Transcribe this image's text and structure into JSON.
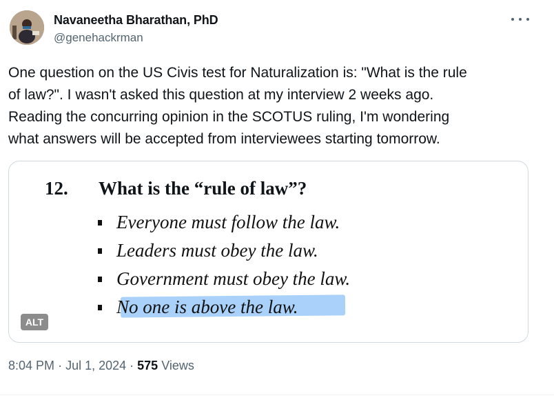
{
  "author": {
    "name": "Navaneetha Bharathan, PhD",
    "handle": "@genehackrman"
  },
  "tweet": {
    "text_lines": [
      "One question on the US Civis test for Naturalization is: \"What is the rule",
      "of law?\". I wasn't asked this question at my interview 2 weeks ago.",
      "Reading the concurring opinion in the SCOTUS ruling, I'm wondering",
      "what answers will be accepted from interviewees starting tomorrow."
    ]
  },
  "media": {
    "question_number": "12.",
    "question": "What is the “rule of law”?",
    "answers": [
      "Everyone must follow the law.",
      "Leaders must obey the law.",
      "Government must obey the law.",
      "No one is above the law."
    ],
    "highlighted_answer_index": 3,
    "highlight_color": "#a9d1fa",
    "alt_label": "ALT"
  },
  "meta": {
    "time": "8:04 PM",
    "date": "Jul 1, 2024",
    "views_count": "575",
    "views_label": "Views"
  },
  "icons": {
    "more": "more-dots-icon"
  }
}
